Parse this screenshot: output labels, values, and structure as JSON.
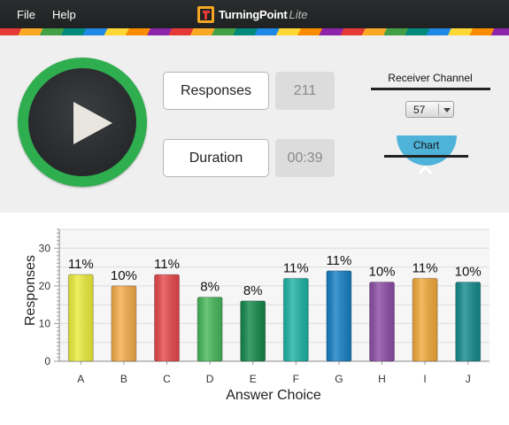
{
  "menu": {
    "file": "File",
    "help": "Help"
  },
  "brand": {
    "name": "TurningPoint",
    "suffix": "Lite"
  },
  "stats": {
    "responses_label": "Responses",
    "responses_value": "211",
    "duration_label": "Duration",
    "duration_value": "00:39"
  },
  "receiver": {
    "label": "Receiver Channel",
    "channel": "57"
  },
  "chart_toggle": {
    "label": "Chart"
  },
  "colors": {
    "play_ring": "#2fae4f",
    "toggle": "#4fb3d9"
  },
  "icons": {
    "play": "play-icon",
    "chart_toggle": "chevron-up-icon",
    "dropdown": "chevron-down-icon"
  },
  "chart_data": {
    "type": "bar",
    "categories": [
      "A",
      "B",
      "C",
      "D",
      "E",
      "F",
      "G",
      "H",
      "I",
      "J"
    ],
    "values": [
      23,
      20,
      23,
      17,
      16,
      22,
      24,
      21,
      22,
      21
    ],
    "data_labels": [
      "11%",
      "10%",
      "11%",
      "8%",
      "8%",
      "11%",
      "11%",
      "10%",
      "11%",
      "10%"
    ],
    "colors": [
      "#ecec3c",
      "#f5ab4a",
      "#e6474a",
      "#46b65a",
      "#12884a",
      "#1db3a4",
      "#157fc4",
      "#8d4ca6",
      "#f2a93a",
      "#138a8b"
    ],
    "xlabel": "Answer Choice",
    "ylabel": "Responses",
    "ylim": [
      0,
      35
    ],
    "yticks": [
      0,
      10,
      20,
      30
    ],
    "grid": true
  }
}
